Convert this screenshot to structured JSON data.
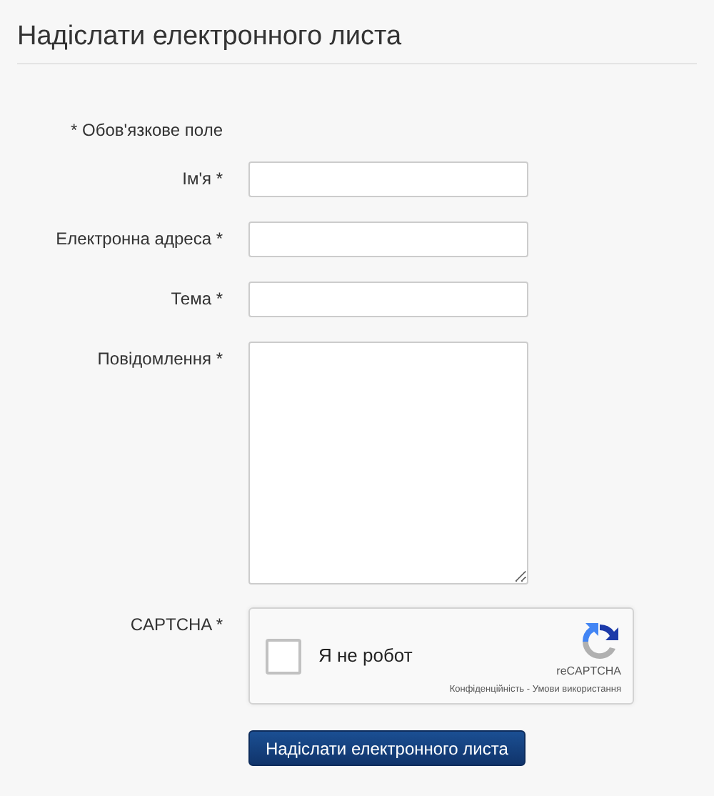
{
  "title": "Надіслати електронного листа",
  "required_note": "* Обов'язкове поле",
  "fields": [
    {
      "kind": "text",
      "label": "Ім'я *"
    },
    {
      "kind": "text",
      "label": "Електронна адреса *"
    },
    {
      "kind": "text",
      "label": "Тема *"
    },
    {
      "kind": "textarea",
      "label": "Повідомлення *"
    }
  ],
  "captcha": {
    "label": "CAPTCHA *",
    "checkbox_label": "Я не робот",
    "checked": false,
    "brand": "reCAPTCHA",
    "privacy_link": "Конфіденційність",
    "separator": " - ",
    "terms_link": "Умови використання"
  },
  "submit_button": "Надіслати електронного листа"
}
